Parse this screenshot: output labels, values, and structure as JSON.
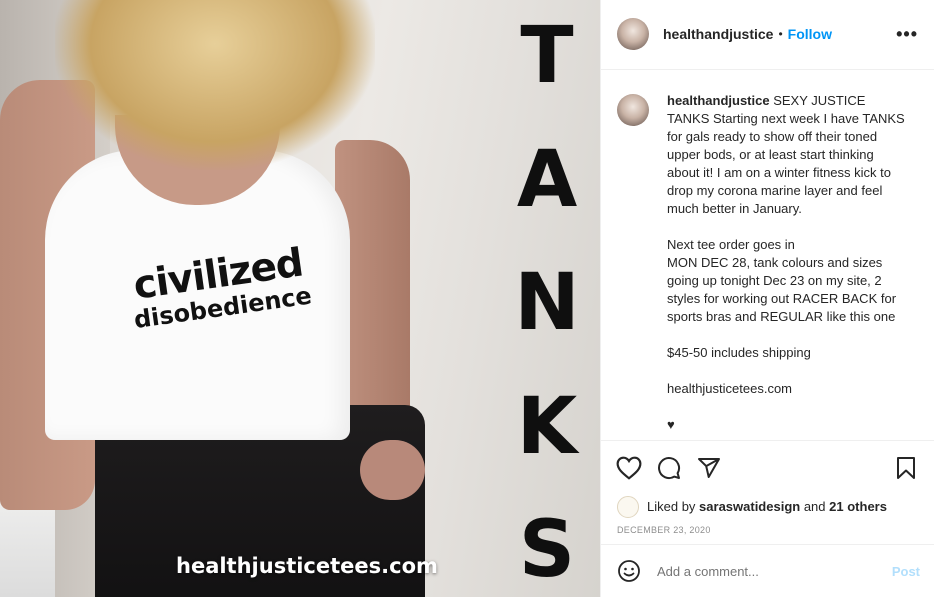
{
  "post": {
    "image": {
      "shirt_line1": "civilized",
      "shirt_line2": "disobedience",
      "side_letters": [
        "T",
        "A",
        "N",
        "K",
        "S"
      ],
      "website": "healthjusticetees.com"
    }
  },
  "header": {
    "username": "healthandjustice",
    "dot": "•",
    "follow_label": "Follow",
    "more_label": "•••"
  },
  "caption": {
    "username": "healthandjustice",
    "paragraphs": [
      "SEXY JUSTICE TANKS Starting next week I have TANKS for gals ready to show off their toned upper bods, or at least start thinking about it! I am on a winter fitness kick to drop my corona marine layer and feel much better in January.",
      "Next tee order goes in\nMON DEC 28, tank colours and sizes going up tonight Dec 23 on my site, 2 styles for working out RACER BACK for sports bras and REGULAR like this one",
      "$45-50 includes shipping",
      "healthjusticetees.com",
      "♥"
    ]
  },
  "actions": {
    "like": "heart-icon",
    "comment": "comment-icon",
    "share": "share-icon",
    "save": "bookmark-icon"
  },
  "likes": {
    "prefix": "Liked by",
    "user": "saraswatidesign",
    "conj": "and",
    "others": "21 others"
  },
  "date": "DECEMBER 23, 2020",
  "comment_box": {
    "placeholder": "Add a comment...",
    "post_label": "Post"
  }
}
